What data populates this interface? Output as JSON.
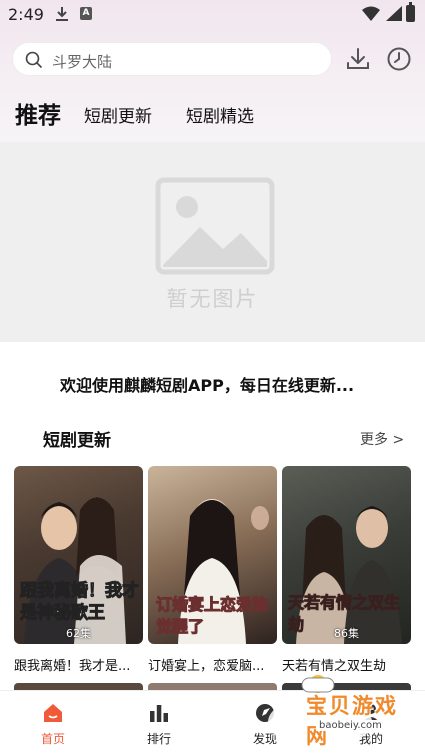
{
  "status_bar": {
    "time": "2:49",
    "note_letter": "A"
  },
  "search": {
    "placeholder": "斗罗大陆"
  },
  "tabs": [
    {
      "label": "推荐",
      "active": true
    },
    {
      "label": "短剧更新",
      "active": false
    },
    {
      "label": "短剧精选",
      "active": false
    }
  ],
  "banner": {
    "placeholder_text": "暂无图片"
  },
  "notice": "欢迎使用麒麟短剧APP，每日在线更新...",
  "section": {
    "title": "短剧更新",
    "more": "更多 >"
  },
  "cards": [
    {
      "title": "跟我离婚！我才是...",
      "poster_text": "跟我离婚！我才是神秘歌王",
      "episodes": "62集"
    },
    {
      "title": "订婚宴上，恋爱脑...",
      "poster_text": "订婚宴上恋爱脑觉醒了",
      "episodes": ""
    },
    {
      "title": "天若有情之双生劫",
      "poster_text": "天若有情之双生劫",
      "episodes": "86集"
    }
  ],
  "nav": [
    {
      "label": "首页",
      "active": true,
      "icon": "home-icon"
    },
    {
      "label": "排行",
      "active": false,
      "icon": "ranking-icon"
    },
    {
      "label": "发现",
      "active": false,
      "icon": "discover-icon"
    },
    {
      "label": "我的",
      "active": false,
      "icon": "profile-icon"
    }
  ],
  "watermark": {
    "name": "宝贝游戏网",
    "url": "baobeiy.com"
  },
  "colors": {
    "accent": "#ee5a3a",
    "banner_bg": "#efefef"
  }
}
